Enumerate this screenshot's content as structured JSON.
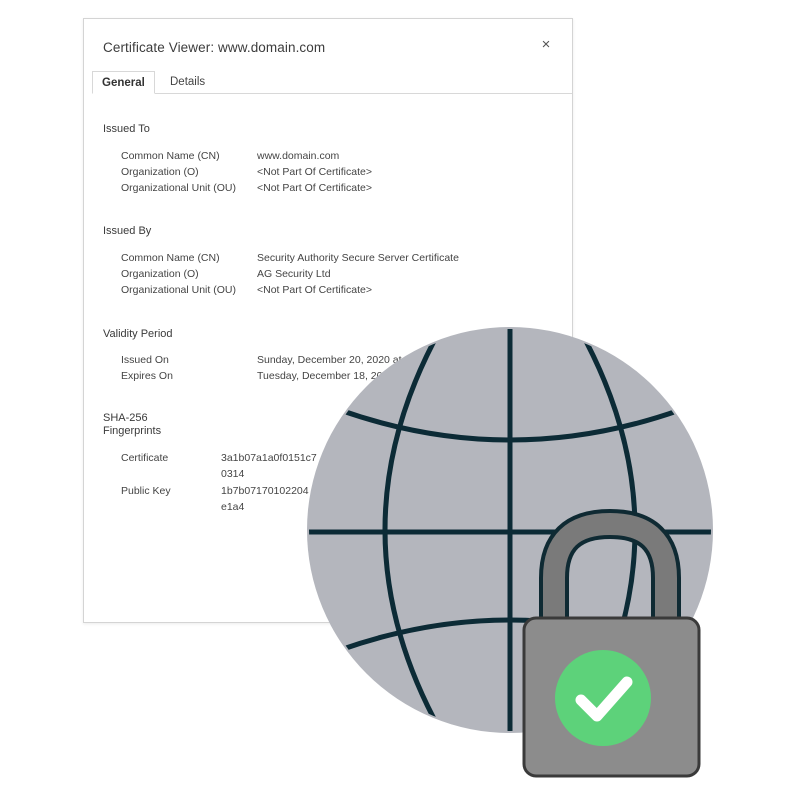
{
  "dialog": {
    "title": "Certificate Viewer: www.domain.com",
    "close_label": "×",
    "tabs": [
      {
        "label": "General"
      },
      {
        "label": "Details"
      }
    ]
  },
  "issued_to": {
    "title": "Issued To",
    "rows": [
      {
        "key": "Common Name (CN)",
        "value": "www.domain.com"
      },
      {
        "key": "Organization (O)",
        "value": "<Not Part Of Certificate>"
      },
      {
        "key": "Organizational Unit (OU)",
        "value": "<Not Part Of Certificate>"
      }
    ]
  },
  "issued_by": {
    "title": "Issued By",
    "rows": [
      {
        "key": "Common Name (CN)",
        "value": "Security Authority Secure Server Certificate"
      },
      {
        "key": "Organization (O)",
        "value": "AG Security Ltd"
      },
      {
        "key": "Organizational Unit (OU)",
        "value": "<Not Part Of Certificate>"
      }
    ]
  },
  "validity": {
    "title": "Validity Period",
    "rows": [
      {
        "key": "Issued On",
        "value": "Sunday, December 20, 2020 at"
      },
      {
        "key": "Expires On",
        "value": "Tuesday, December 18, 20"
      }
    ]
  },
  "fingerprints": {
    "title_line1": "SHA-256",
    "title_line2": "Fingerprints",
    "rows": [
      {
        "key": "Certificate",
        "value": "3a1b07a1a0f0151c7",
        "cont": "0314"
      },
      {
        "key": "Public Key",
        "value": "1b7b07170102204",
        "cont": "e1a4"
      }
    ]
  },
  "icons": {
    "globe": "globe-icon",
    "lock": "padlock-icon",
    "check": "checkmark-icon"
  },
  "colors": {
    "globe_fill": "#b4b6bd",
    "globe_lines": "#0c2b36",
    "lock_body": "#8c8c8c",
    "lock_shackle": "#7a7a7a",
    "check_circle": "#5dd27a",
    "check_mark": "#ffffff"
  }
}
